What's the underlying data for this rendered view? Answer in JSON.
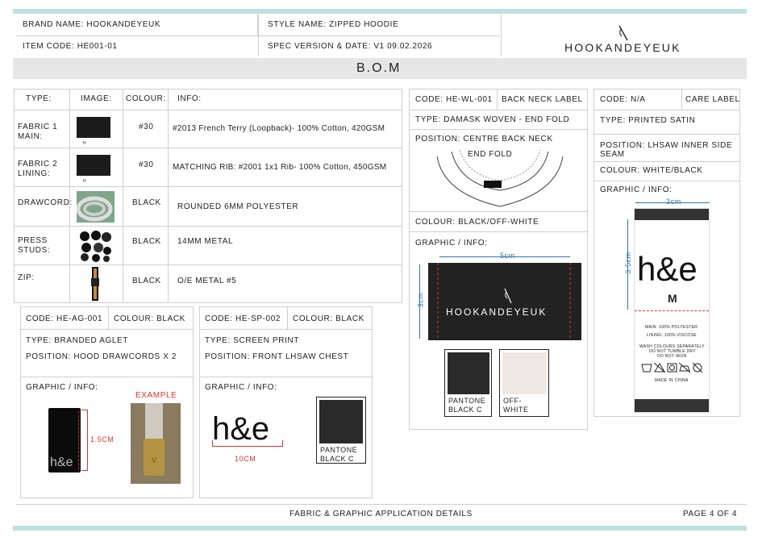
{
  "header": {
    "brand": "BRAND NAME: HOOKANDEYEUK",
    "style": "STYLE NAME: ZIPPED HOODIE",
    "item": "ITEM CODE: HE001-01",
    "spec": "SPEC VERSION & DATE: V1 09.02.2026",
    "logo": "HOOKANDEYEUK"
  },
  "section_title": "B.O.M",
  "bom": {
    "headers": [
      "TYPE:",
      "IMAGE:",
      "COLOUR:",
      "INFO:"
    ],
    "rows": [
      {
        "type": "FABRIC 1 MAIN:",
        "colour": "#30",
        "info": "#2013 French Terry (Loopback)- 100% Cotton, 420GSM",
        "img_note": "H"
      },
      {
        "type": "FABRIC 2 LINING:",
        "colour": "#30",
        "info": "MATCHING RIB: #2001 1x1 Rib- 100% Cotton, 450GSM",
        "img_note": "H"
      },
      {
        "type": "DRAWCORD:",
        "colour": "BLACK",
        "info": "ROUNDED 6MM POLYESTER"
      },
      {
        "type": "PRESS STUDS:",
        "colour": "BLACK",
        "info": "14MM METAL"
      },
      {
        "type": "ZIP:",
        "colour": "BLACK",
        "info": "O/E METAL #5"
      }
    ]
  },
  "aglet": {
    "code": "CODE: HE-AG-001",
    "colour": "COLOUR: BLACK",
    "type": "TYPE: BRANDED AGLET",
    "position": "POSITION: HOOD DRAWCORDS X 2",
    "graphic": "GRAPHIC / INFO:",
    "example": "EXAMPLE",
    "dim": "1.5CM",
    "mark": "h&e"
  },
  "print": {
    "code": "CODE: HE-SP-002",
    "colour": "COLOUR: BLACK",
    "type": "TYPE: SCREEN PRINT",
    "position": "POSITION: FRONT LHSAW CHEST",
    "graphic": "GRAPHIC / INFO:",
    "mark": "h&e",
    "dim": "10CM",
    "pantone": "PANTONE BLACK C"
  },
  "woven": {
    "code": "CODE: HE-WL-001",
    "name": "BACK NECK LABEL",
    "type": "TYPE: DAMASK WOVEN - END FOLD",
    "position": "POSITION: CENTRE BACK NECK",
    "end_fold": "END FOLD",
    "colour": "COLOUR: BLACK/OFF-WHITE",
    "graphic": "GRAPHIC / INFO:",
    "w": "5cm",
    "h": "3cm",
    "logo": "HOOKANDEYEUK",
    "swatches": [
      "PANTONE BLACK C",
      "OFF- WHITE"
    ]
  },
  "care": {
    "code": "CODE: N/A",
    "name": "CARE LABEL",
    "type": "TYPE: PRINTED SATIN",
    "position": "POSITION: LHSAW INNER SIDE SEAM",
    "colour": "COLOUR: WHITE/BLACK",
    "graphic": "GRAPHIC / INFO:",
    "w": "3cm",
    "h": "3.5cm",
    "mark": "h&e",
    "size": "M",
    "main": "MAIN: 100% POLYESTER",
    "lining": "LINING: 100% VISCOSE",
    "wash1": "WASH COLOURS SEPARATELY",
    "wash2": "DO NOT TUMBLE DRY",
    "wash3": "DO NOT IRON",
    "made": "MADE IN CHINA"
  },
  "footer": {
    "center": "FABRIC & GRAPHIC APPLICATION DETAILS",
    "page": "PAGE 4 OF 4"
  },
  "colors": {
    "accent_bar": "#bfe0e2",
    "dim_blue": "#2e75b6",
    "dash_red": "#d9352b",
    "example_red": "#d9352b"
  }
}
